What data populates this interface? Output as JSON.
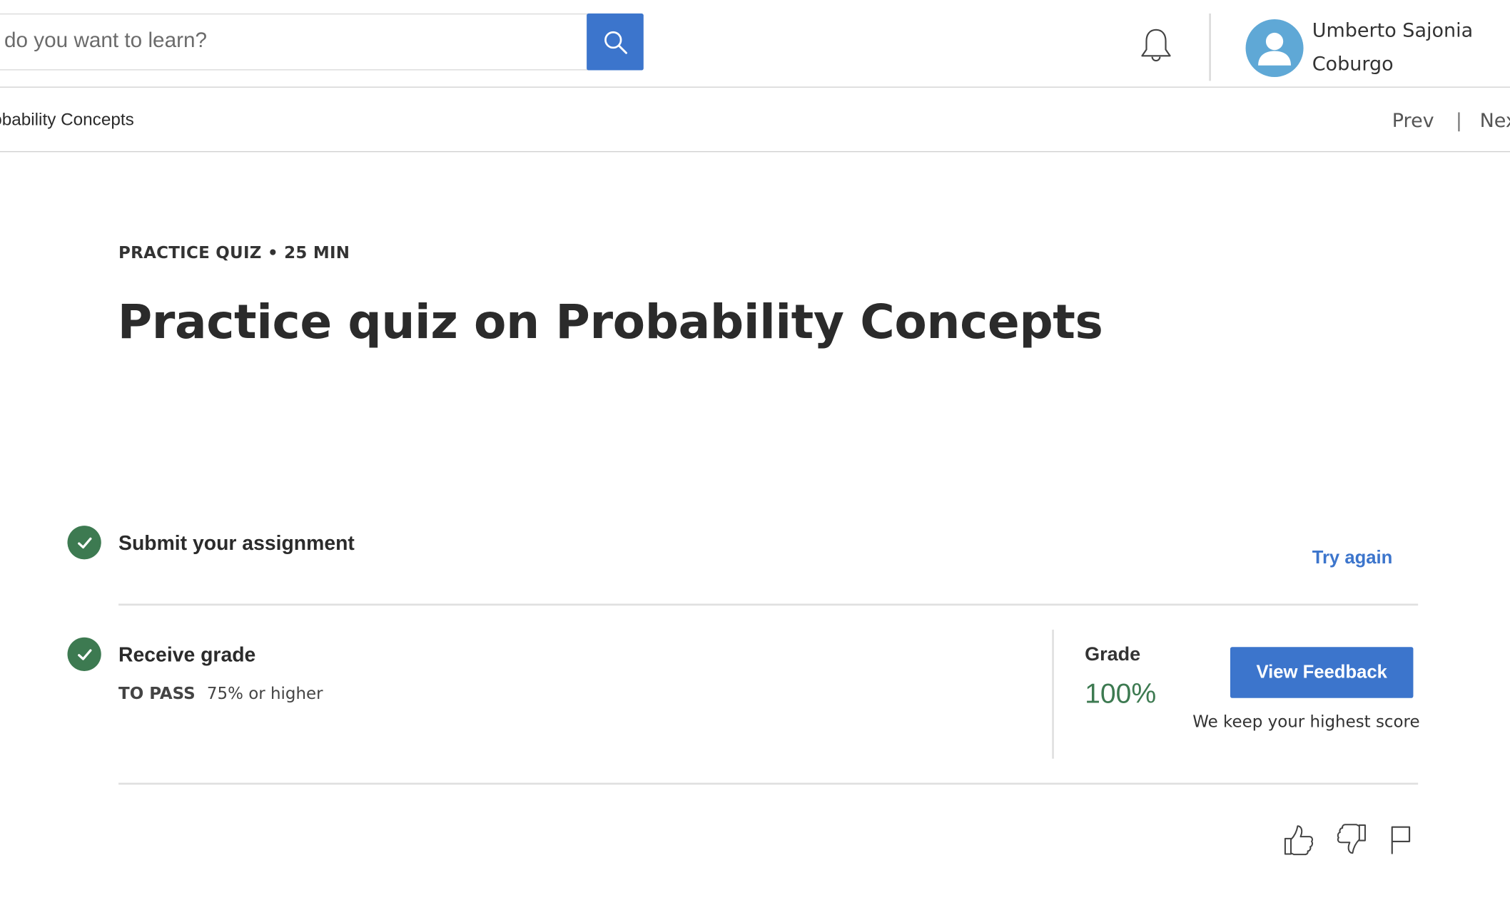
{
  "header": {
    "search": {
      "placeholder": "at do you want to learn?"
    },
    "icons": {
      "search": "search-icon",
      "notifications": "bell-icon",
      "avatar": "user-silhouette-icon"
    },
    "user": {
      "name_line1": "Umberto Sajonia",
      "name_line2": "Coburgo"
    }
  },
  "breadcrumb": {
    "current": "obability Concepts",
    "prev": "Prev",
    "separator": "|",
    "next": "Nex"
  },
  "quiz": {
    "meta": "PRACTICE QUIZ • 25 MIN",
    "title": "Practice quiz on Probability Concepts"
  },
  "steps": {
    "submit": {
      "label": "Submit your assignment",
      "status": "complete",
      "action": "Try again"
    },
    "receive": {
      "label": "Receive grade",
      "status": "complete",
      "to_pass_label": "TO PASS",
      "to_pass_value": "75% or higher",
      "grade_label": "Grade",
      "grade_value": "100%",
      "button": "View Feedback",
      "note": "We keep your highest score"
    }
  },
  "footer_icons": [
    "thumbs-up-icon",
    "thumbs-down-icon",
    "flag-icon"
  ],
  "colors": {
    "accent": "#3c75cc",
    "success": "#3d7a51",
    "avatar_bg": "#5fa8d6",
    "text": "#333333",
    "divider": "#e0e0e0"
  }
}
